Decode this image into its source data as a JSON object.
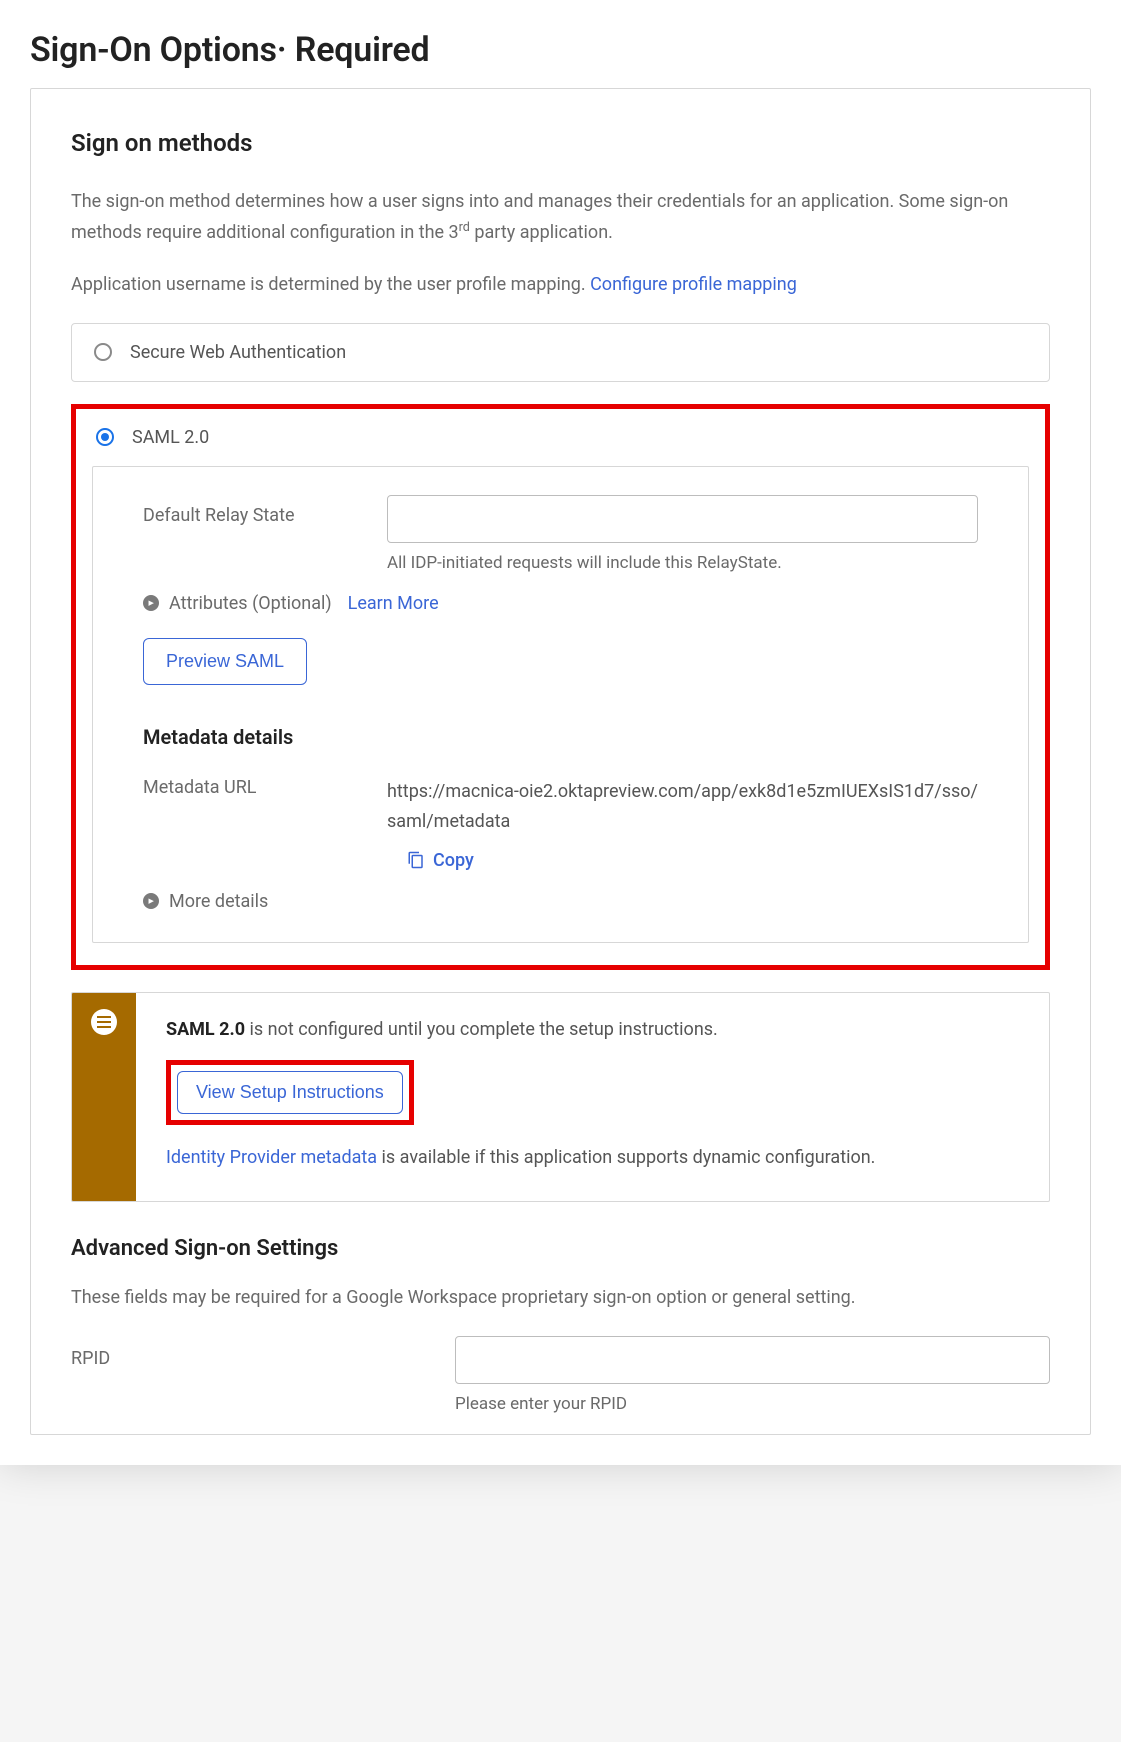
{
  "pageTitle": "Sign-On Options· Required",
  "section": {
    "heading": "Sign on methods",
    "intro_pre": "The sign-on method determines how a user signs into and manages their credentials for an application. Some sign-on methods require additional configuration in the 3",
    "intro_sup": "rd",
    "intro_post": " party application.",
    "usernameNote": "Application username is determined by the user profile mapping. ",
    "configureLink": "Configure profile mapping"
  },
  "methods": {
    "swa": {
      "label": "Secure Web Authentication",
      "selected": false
    },
    "saml": {
      "label": "SAML 2.0",
      "selected": true
    }
  },
  "samlPanel": {
    "relay": {
      "label": "Default Relay State",
      "value": "",
      "help": "All IDP-initiated requests will include this RelayState."
    },
    "attributes": {
      "label": "Attributes (Optional)",
      "learnMore": "Learn More"
    },
    "previewBtn": "Preview SAML",
    "metadata": {
      "heading": "Metadata details",
      "urlLabel": "Metadata URL",
      "urlValue": "https://macnica-oie2.oktapreview.com/app/exk8d1e5zmIUEXsIS1d7/sso/saml/metadata",
      "copy": "Copy"
    },
    "moreDetails": "More details"
  },
  "notice": {
    "strong": "SAML 2.0",
    "line1_rest": " is not configured until you complete the setup instructions.",
    "setupBtn": "View Setup Instructions",
    "idpLink": "Identity Provider metadata",
    "idpRest": " is available if this application supports dynamic configuration."
  },
  "advanced": {
    "heading": "Advanced Sign-on Settings",
    "desc": "These fields may be required for a Google Workspace proprietary sign-on option or general setting.",
    "rpid": {
      "label": "RPID",
      "value": "",
      "placeholder": "",
      "help": "Please enter your RPID"
    }
  }
}
